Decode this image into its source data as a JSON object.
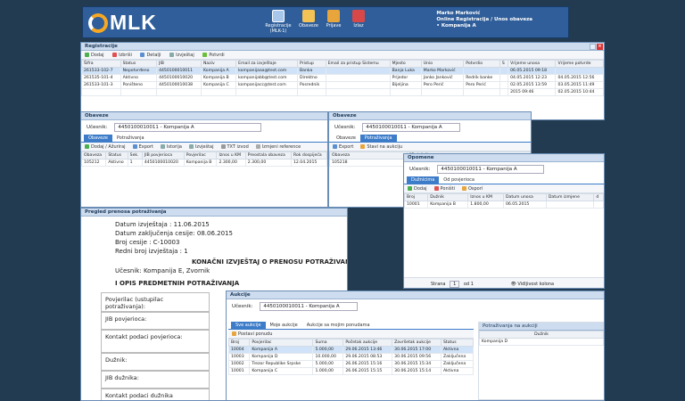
{
  "app": {
    "logo_text": "MLK",
    "nav": [
      {
        "label": "Registracije (MLK-1)",
        "icon": "registration-icon",
        "color": "#a7c6ea"
      },
      {
        "label": "Obaveze",
        "icon": "folder-icon",
        "color": "#f3c455"
      },
      {
        "label": "Prijave",
        "icon": "book-icon",
        "color": "#e7a53b"
      },
      {
        "label": "Izlaz",
        "icon": "exit-icon",
        "color": "#d94848"
      }
    ],
    "user_name": "Marko Marković",
    "user_location": "Online Registracija / Unos obaveza",
    "user_company": "Kompanija A"
  },
  "registracije": {
    "title": "Registracije",
    "toolbar": [
      "Dodaj",
      "Izbriši",
      "Detalji",
      "Izvještaj",
      "Potvrdi"
    ],
    "columns": [
      "Šifra",
      "Status",
      "JIB",
      "Naziv",
      "Email za izvještaje",
      "Pristup",
      "Email za pristup Sistemu",
      "Mjesto",
      "Unio",
      "Potvrdio",
      "S",
      "Vrijeme unosa",
      "Vrijeme potvrde"
    ],
    "rows": [
      [
        "261533-102-7",
        "Nepotvrđeno",
        "4450100010011",
        "Kompanija A",
        "kompanijaaa@test.com",
        "Banka",
        "",
        "Banja Luka",
        "Marko Marković",
        "",
        "",
        "06.05.2015 09:18",
        ""
      ],
      [
        "261535-101-4",
        "Aktivno",
        "4450100010020",
        "Kompanija B",
        "kompanijabb@test.com",
        "Direktno",
        "",
        "Prijedor",
        "Janko Janković",
        "Redrik banke",
        "",
        "04.05.2015 12:23",
        "04.05.2015 12:56"
      ],
      [
        "261533-101-3",
        "Poništeno",
        "4450100010038",
        "Kompanija C",
        "kompanijacc@test.com",
        "Posrednik",
        "",
        "Bijeljina",
        "Pero Perić",
        "Pero Perić",
        "",
        "02.05.2015 13:59",
        "03.05.2015 11:49"
      ],
      [
        "",
        "",
        "",
        "",
        "",
        "",
        "",
        "",
        "",
        "",
        "",
        "2015 09:46",
        "02.05.2015 10:44"
      ]
    ]
  },
  "obaveze1": {
    "title": "Obaveze",
    "ucesnik_label": "Učesnik:",
    "ucesnik_value": "4450100010011 - Kompanija A",
    "tabs": [
      "Obaveze",
      "Potraživanja"
    ],
    "toolbar": [
      "Dodaj / Ažuriraj",
      "Export",
      "Istorija",
      "Izvještaj",
      "TXT izvod",
      "Izmjeni reference"
    ],
    "columns": [
      "Obaveza",
      "Status",
      "Sek.",
      "JIB povjerioca",
      "Povjerilac",
      "Iznos u KM",
      "Preostala obaveza",
      "Rok dospijeća"
    ],
    "rows": [
      [
        "105212",
        "Aktivno",
        "1",
        "4450100010020",
        "Kompanija B",
        "2.300,00",
        "2.300,00",
        "12.04.2015"
      ]
    ]
  },
  "obaveze2": {
    "title": "Obaveze",
    "ucesnik_label": "Učesnik:",
    "ucesnik_value": "4450100010011 - Kompanija A",
    "tabs": [
      "Obaveze",
      "Potraživanja"
    ],
    "toolbar": [
      "Export",
      "Stavi na aukciju"
    ],
    "columns": [
      "Obaveza",
      "JIB dužnika"
    ],
    "rows": [
      [
        "105218",
        "445010001009"
      ]
    ]
  },
  "opomene": {
    "title": "Opomene",
    "ucesnik_label": "Učesnik:",
    "ucesnik_value": "4450100010011 - Kompanija A",
    "tabs": [
      "Dužnicima",
      "Od povjerioca"
    ],
    "toolbar": [
      "Dodaj",
      "Poništi",
      "Osporí"
    ],
    "columns": [
      "Broj",
      "Dužnik",
      "Iznos u KM",
      "Datum unosa",
      "Datum izmjene",
      "d"
    ],
    "rows": [
      [
        "10001",
        "Kompanija B",
        "1.800,00",
        "06.05.2015",
        "",
        ""
      ]
    ],
    "pager_label": "Strana",
    "pager_value": "1",
    "pager_of": "od 1",
    "visible_columns": "Vidljivost kolona"
  },
  "report": {
    "title": "Pregled prenosa potraživanja",
    "lines": [
      "Datum izvještaja : 11.06.2015",
      "Datum zaključenja cesije: 08.06.2015",
      "Broj cesije : C-10003",
      "Redni broj izvještaja : 1"
    ],
    "heading": "KONAČNI IZVJEŠTAJ O PRENOSU POTRAŽIVANJA (CESIJI)",
    "ucesnik": "Učesnik: Kompanija E, Zvornik",
    "section": "I OPIS PREDMETNIH POTRAŽIVANJA",
    "boxes": [
      "Povjerilac (ustupilac potraživanja):",
      "JIB povjerioca:",
      "Kontakt podaci povjerioca:",
      "Dužnik:",
      "JIB dužnika:",
      "Kontakt podaci dužnika"
    ]
  },
  "aukcije": {
    "title": "Aukcije",
    "ucesnik_label": "Učesnik:",
    "ucesnik_value": "4450100010011 - Kompanija A",
    "tabs": [
      "Sve aukcije",
      "Moje aukcije",
      "Aukcije sa mojim ponudama"
    ],
    "toolbar": "Postavi ponudu",
    "columns": [
      "Broj",
      "Povjerilac",
      "Suma",
      "Početak aukcije",
      "Završetak aukcije",
      "Status"
    ],
    "rows": [
      [
        "10004",
        "Kompanija A",
        "5.000,00",
        "29.06.2015 13:46",
        "30.06.2015 17:00",
        "Aktivna"
      ],
      [
        "10003",
        "Kompanija D",
        "10.000,00",
        "29.06.2015 08:53",
        "30.06.2015 09:56",
        "Zaključena"
      ],
      [
        "10002",
        "Trezor Republike Srpske",
        "5.000,00",
        "26.06.2015 15:16",
        "30.06.2015 15:34",
        "Zaključena"
      ],
      [
        "10001",
        "Kompanija C",
        "1.000,00",
        "26.06.2015 15:15",
        "30.06.2015 15:14",
        "Aktivna"
      ]
    ],
    "side_title": "Potraživanja na aukciji",
    "side_column": "Dužnik",
    "side_rows": [
      "Kompanija D"
    ]
  }
}
